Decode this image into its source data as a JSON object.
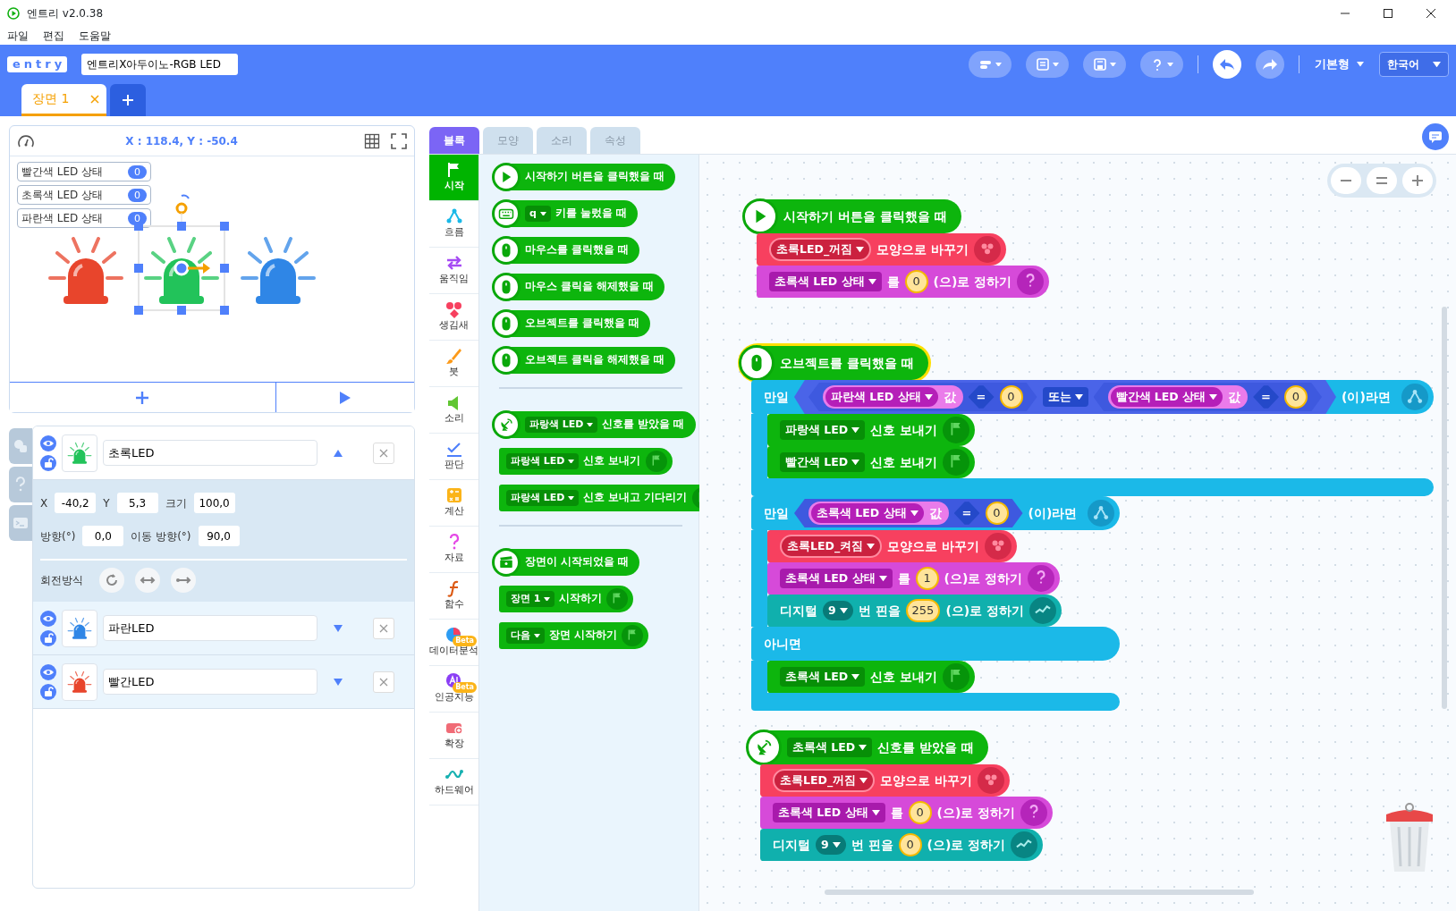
{
  "window": {
    "title": "엔트리 v2.0.38"
  },
  "menu": [
    "파일",
    "편집",
    "도움말"
  ],
  "header": {
    "logo": "entry",
    "project_title": "엔트리X아두이노-RGB LED",
    "mode": "기본형",
    "language": "한국어"
  },
  "scene_tabs": [
    {
      "label": "장면 1",
      "selected": true
    }
  ],
  "stage": {
    "coordinates": "X : 118.4, Y : -50.4",
    "variables": [
      {
        "name": "빨간색 LED 상태",
        "value": "0"
      },
      {
        "name": "초록색 LED 상태",
        "value": "0"
      },
      {
        "name": "파란색 LED 상태",
        "value": "0"
      }
    ],
    "sprites": [
      {
        "color": "#e8452c",
        "selected": false
      },
      {
        "color": "#22c35a",
        "selected": true
      },
      {
        "color": "#2f86e6",
        "selected": false
      }
    ]
  },
  "objects": [
    {
      "name": "초록LED",
      "color": "#22c35a",
      "selected": true,
      "expanded": true,
      "fields": [
        {
          "label": "X",
          "value": "-40,2"
        },
        {
          "label": "Y",
          "value": "5,3"
        },
        {
          "label": "크기",
          "value": "100,0"
        },
        {
          "label": "방향(°)",
          "value": "0,0"
        },
        {
          "label": "이동 방향(°)",
          "value": "90,0"
        }
      ],
      "rotation_label": "회전방식"
    },
    {
      "name": "파란LED",
      "color": "#2f86e6",
      "selected": false,
      "expanded": false
    },
    {
      "name": "빨간LED",
      "color": "#e8452c",
      "selected": false,
      "expanded": false
    }
  ],
  "editor_tabs": [
    {
      "label": "블록",
      "selected": true
    },
    {
      "label": "모양",
      "selected": false
    },
    {
      "label": "소리",
      "selected": false
    },
    {
      "label": "속성",
      "selected": false
    }
  ],
  "categories": [
    {
      "label": "시작",
      "selected": true
    },
    {
      "label": "흐름",
      "selected": false
    },
    {
      "label": "움직임",
      "selected": false
    },
    {
      "label": "생김새",
      "selected": false
    },
    {
      "label": "붓",
      "selected": false
    },
    {
      "label": "소리",
      "selected": false
    },
    {
      "label": "판단",
      "selected": false
    },
    {
      "label": "계산",
      "selected": false
    },
    {
      "label": "자료",
      "selected": false
    },
    {
      "label": "함수",
      "selected": false
    },
    {
      "label": "데이터분석",
      "selected": false,
      "badge": "Beta"
    },
    {
      "label": "인공지능",
      "selected": false,
      "badge": "Beta"
    },
    {
      "label": "확장",
      "selected": false
    },
    {
      "label": "하드웨어",
      "selected": false
    }
  ],
  "palette": [
    {
      "kind": "when_start",
      "parts": [
        {
          "kind": "text",
          "text": "시작하기 버튼을 클릭했을 때"
        }
      ]
    },
    {
      "kind": "when_key",
      "parts": [
        {
          "kind": "dropdown",
          "text": "q"
        },
        {
          "kind": "text",
          "text": "키를 눌렀을 때"
        }
      ]
    },
    {
      "kind": "when_mouse",
      "parts": [
        {
          "kind": "text",
          "text": "마우스를 클릭했을 때"
        }
      ]
    },
    {
      "kind": "when_mouse",
      "parts": [
        {
          "kind": "text",
          "text": "마우스 클릭을 해제했을 때"
        }
      ]
    },
    {
      "kind": "when_mouse",
      "parts": [
        {
          "kind": "text",
          "text": "오브젝트를 클릭했을 때"
        }
      ]
    },
    {
      "kind": "when_mouse",
      "parts": [
        {
          "kind": "text",
          "text": "오브젝트 클릭을 해제했을 때"
        }
      ]
    },
    {
      "kind": "divider"
    },
    {
      "kind": "when_signal",
      "parts": [
        {
          "kind": "dropdown",
          "text": "파랑색 LED"
        },
        {
          "kind": "text",
          "text": "신호를 받았을 때"
        }
      ]
    },
    {
      "kind": "event_stack",
      "parts": [
        {
          "kind": "dropdown",
          "text": "파랑색 LED"
        },
        {
          "kind": "text",
          "text": "신호 보내기"
        }
      ]
    },
    {
      "kind": "event_stack",
      "parts": [
        {
          "kind": "dropdown",
          "text": "파랑색 LED"
        },
        {
          "kind": "text",
          "text": "신호 보내고 기다리기"
        }
      ]
    },
    {
      "kind": "divider"
    },
    {
      "kind": "when_scene",
      "parts": [
        {
          "kind": "text",
          "text": "장면이 시작되었을 때"
        }
      ]
    },
    {
      "kind": "event_stack",
      "parts": [
        {
          "kind": "dropdown",
          "text": "장면 1"
        },
        {
          "kind": "text",
          "text": "시작하기"
        }
      ]
    },
    {
      "kind": "event_stack",
      "parts": [
        {
          "kind": "dropdown",
          "text": "다음"
        },
        {
          "kind": "text",
          "text": "장면 시작하기"
        }
      ]
    }
  ],
  "scripts": [
    {
      "highlighted": false,
      "blocks": [
        {
          "kind": "when_start",
          "parts": [
            {
              "kind": "text",
              "text": "시작하기 버튼을 클릭했을 때"
            }
          ]
        },
        {
          "kind": "looks",
          "parts": [
            {
              "kind": "dropdown",
              "text": "초록LED_꺼짐"
            },
            {
              "kind": "text",
              "text": "모양으로 바꾸기"
            }
          ]
        },
        {
          "kind": "variable",
          "parts": [
            {
              "kind": "dropdown",
              "text": "초록색 LED 상태"
            },
            {
              "kind": "text",
              "text": "를"
            },
            {
              "kind": "number",
              "text": "0"
            },
            {
              "kind": "text",
              "text": "(으)로 정하기"
            }
          ]
        }
      ]
    },
    {
      "highlighted": true,
      "blocks": [
        {
          "kind": "when_mouse",
          "parts": [
            {
              "kind": "text",
              "text": "오브젝트를 클릭했을 때"
            }
          ]
        },
        {
          "kind": "if",
          "head": [
            {
              "kind": "text",
              "text": "만일"
            },
            {
              "kind": "bool",
              "parts": [
                {
                  "kind": "compare",
                  "parts": [
                    {
                      "kind": "value",
                      "text": "파란색 LED 상태",
                      "suffix": "값"
                    },
                    {
                      "kind": "op",
                      "text": "="
                    },
                    {
                      "kind": "number",
                      "text": "0"
                    }
                  ]
                },
                {
                  "kind": "dropdown",
                  "text": "또는"
                },
                {
                  "kind": "compare",
                  "parts": [
                    {
                      "kind": "value",
                      "text": "빨간색 LED 상태",
                      "suffix": "값"
                    },
                    {
                      "kind": "op",
                      "text": "="
                    },
                    {
                      "kind": "number",
                      "text": "0"
                    }
                  ]
                }
              ]
            },
            {
              "kind": "text",
              "text": "(이)라면"
            }
          ],
          "body": [
            {
              "kind": "event_stack",
              "parts": [
                {
                  "kind": "dropdown",
                  "text": "파랑색 LED"
                },
                {
                  "kind": "text",
                  "text": "신호 보내기"
                }
              ]
            },
            {
              "kind": "event_stack",
              "parts": [
                {
                  "kind": "dropdown",
                  "text": "빨간색 LED"
                },
                {
                  "kind": "text",
                  "text": "신호 보내기"
                }
              ]
            }
          ]
        },
        {
          "kind": "ifelse",
          "head": [
            {
              "kind": "text",
              "text": "만일"
            },
            {
              "kind": "compare",
              "parts": [
                {
                  "kind": "value",
                  "text": "초록색 LED 상태",
                  "suffix": "값"
                },
                {
                  "kind": "op",
                  "text": "="
                },
                {
                  "kind": "number",
                  "text": "0"
                }
              ]
            },
            {
              "kind": "text",
              "text": "(이)라면"
            }
          ],
          "body": [
            {
              "kind": "looks",
              "parts": [
                {
                  "kind": "dropdown",
                  "text": "초록LED_켜짐"
                },
                {
                  "kind": "text",
                  "text": "모양으로 바꾸기"
                }
              ]
            },
            {
              "kind": "variable",
              "parts": [
                {
                  "kind": "dropdown",
                  "text": "초록색 LED 상태"
                },
                {
                  "kind": "text",
                  "text": "를"
                },
                {
                  "kind": "number",
                  "text": "1"
                },
                {
                  "kind": "text",
                  "text": "(으)로 정하기"
                }
              ]
            },
            {
              "kind": "hardware",
              "parts": [
                {
                  "kind": "text",
                  "text": "디지털"
                },
                {
                  "kind": "dropdown",
                  "text": "9"
                },
                {
                  "kind": "text",
                  "text": "번 핀을"
                },
                {
                  "kind": "number",
                  "text": "255"
                },
                {
                  "kind": "text",
                  "text": "(으)로 정하기"
                }
              ]
            }
          ],
          "else_label": "아니면",
          "else_body": [
            {
              "kind": "event_stack",
              "parts": [
                {
                  "kind": "dropdown",
                  "text": "초록색 LED"
                },
                {
                  "kind": "text",
                  "text": "신호 보내기"
                }
              ]
            }
          ]
        }
      ]
    },
    {
      "highlighted": false,
      "blocks": [
        {
          "kind": "when_signal",
          "parts": [
            {
              "kind": "dropdown",
              "text": "초록색 LED"
            },
            {
              "kind": "text",
              "text": "신호를 받았을 때"
            }
          ]
        },
        {
          "kind": "looks",
          "parts": [
            {
              "kind": "dropdown",
              "text": "초록LED_꺼짐"
            },
            {
              "kind": "text",
              "text": "모양으로 바꾸기"
            }
          ]
        },
        {
          "kind": "variable",
          "parts": [
            {
              "kind": "dropdown",
              "text": "초록색 LED 상태"
            },
            {
              "kind": "text",
              "text": "를"
            },
            {
              "kind": "number",
              "text": "0"
            },
            {
              "kind": "text",
              "text": "(으)로 정하기"
            }
          ]
        },
        {
          "kind": "hardware",
          "parts": [
            {
              "kind": "text",
              "text": "디지털"
            },
            {
              "kind": "dropdown",
              "text": "9"
            },
            {
              "kind": "text",
              "text": "번 핀을"
            },
            {
              "kind": "number",
              "text": "0"
            },
            {
              "kind": "text",
              "text": "(으)로 정하기"
            }
          ]
        }
      ]
    }
  ]
}
